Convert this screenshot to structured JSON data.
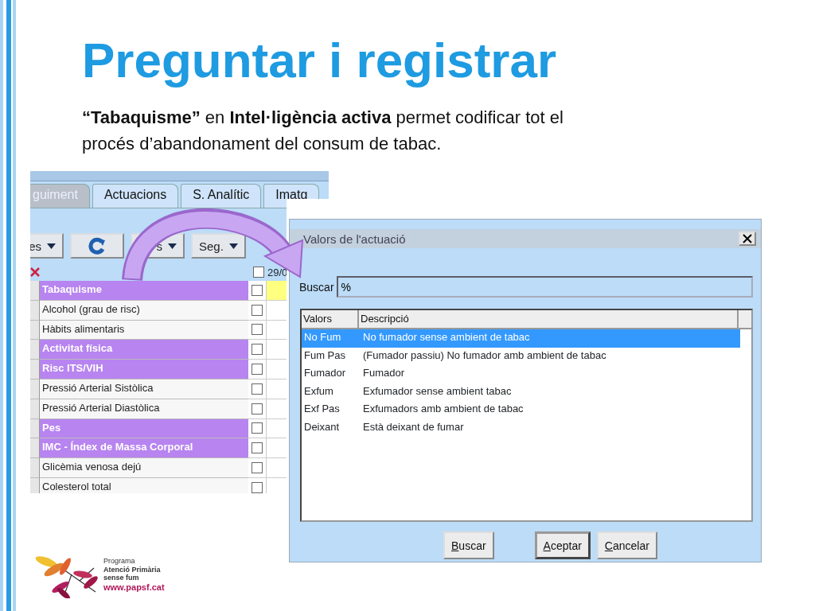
{
  "slide": {
    "title": "Preguntar i registrar",
    "text": "**“Tabaquisme”** en **Intel·ligència activa** permet codificar tot el procés d’abandonament del consum de tabac."
  },
  "app": {
    "tabs": [
      {
        "label": "guiment",
        "selected": true
      },
      {
        "label": "Actuacions",
        "selected": false
      },
      {
        "label": "S. Analític",
        "selected": false
      },
      {
        "label": "Imatg",
        "selected": false
      }
    ],
    "toolbar": [
      {
        "kind": "dropdown",
        "label": "es"
      },
      {
        "kind": "refresh"
      },
      {
        "kind": "dropdown",
        "label": "s"
      },
      {
        "kind": "dropdown",
        "label": "Seg."
      }
    ],
    "header": {
      "checked": false,
      "date": "29/0"
    },
    "rows": [
      {
        "label": "Tabaquisme",
        "kind": "group",
        "checked": false,
        "marked": true
      },
      {
        "label": "Alcohol (grau de risc)",
        "kind": "item",
        "checked": false,
        "marked": false
      },
      {
        "label": "Hàbits alimentaris",
        "kind": "item",
        "checked": false,
        "marked": false
      },
      {
        "label": "Activitat física",
        "kind": "group",
        "checked": false,
        "marked": false
      },
      {
        "label": "Risc ITS/VIH",
        "kind": "group",
        "checked": false,
        "marked": false
      },
      {
        "label": "Pressió Arterial Sistòlica",
        "kind": "item",
        "checked": false,
        "marked": false
      },
      {
        "label": "Pressió Arterial Diastòlica",
        "kind": "item",
        "checked": false,
        "marked": false
      },
      {
        "label": "Pes",
        "kind": "group",
        "checked": false,
        "marked": false
      },
      {
        "label": "IMC - Índex de Massa Corporal",
        "kind": "group",
        "checked": false,
        "marked": false
      },
      {
        "label": "Glicèmia venosa dejú",
        "kind": "item",
        "checked": false,
        "marked": false
      },
      {
        "label": "Colesterol total",
        "kind": "item",
        "checked": false,
        "marked": false
      }
    ]
  },
  "dialog": {
    "title": "Valors de l'actuació",
    "search": {
      "label": "Buscar",
      "value": "%"
    },
    "columns": [
      "Valors",
      "Descripció"
    ],
    "rows": [
      {
        "code": "No Fum",
        "description": "No fumador sense ambient de tabac",
        "selected": true
      },
      {
        "code": "Fum Pas",
        "description": "(Fumador passiu) No fumador amb ambient de tabac",
        "selected": false
      },
      {
        "code": "Fumador",
        "description": "Fumador",
        "selected": false
      },
      {
        "code": "Exfum",
        "description": "Exfumador sense ambient tabac",
        "selected": false
      },
      {
        "code": "Exf Pas",
        "description": "Exfumadors amb ambient de tabac",
        "selected": false
      },
      {
        "code": "Deixant",
        "description": "Està deixant de fumar",
        "selected": false
      }
    ],
    "buttons": [
      {
        "label": "Buscar",
        "default": false
      },
      {
        "label": "Aceptar",
        "default": true
      },
      {
        "label": "Cancelar",
        "default": false
      }
    ]
  },
  "logo": {
    "lines": [
      "Programa",
      "Atenció Primària",
      "sense fum"
    ],
    "url": "www.papsf.cat"
  }
}
